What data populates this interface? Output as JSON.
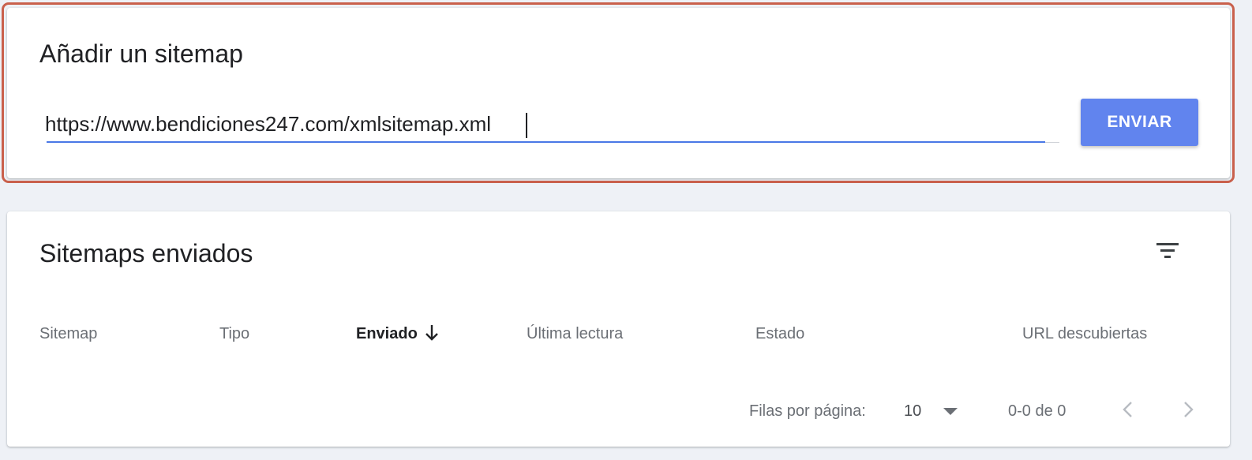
{
  "add_sitemap": {
    "title": "Añadir un sitemap",
    "input_value": "https://www.bendiciones247.com/xmlsitemap.xml",
    "submit_label": "ENVIAR"
  },
  "submitted_sitemaps": {
    "title": "Sitemaps enviados",
    "filter_icon": "filter-list-icon",
    "columns": {
      "sitemap": "Sitemap",
      "tipo": "Tipo",
      "enviado": "Enviado",
      "ultima_lectura": "Última lectura",
      "estado": "Estado",
      "url_descubiertas": "URL descubiertas"
    },
    "sorted_column": "enviado",
    "sort_direction": "descending",
    "rows": [],
    "pagination": {
      "rows_per_page_label": "Filas por página:",
      "rows_per_page_value": "10",
      "range_text": "0-0 de 0"
    }
  },
  "colors": {
    "accent": "#6184ee",
    "underline": "#4a78e6",
    "highlight_frame": "#c9604c",
    "background": "#eef1f6"
  }
}
